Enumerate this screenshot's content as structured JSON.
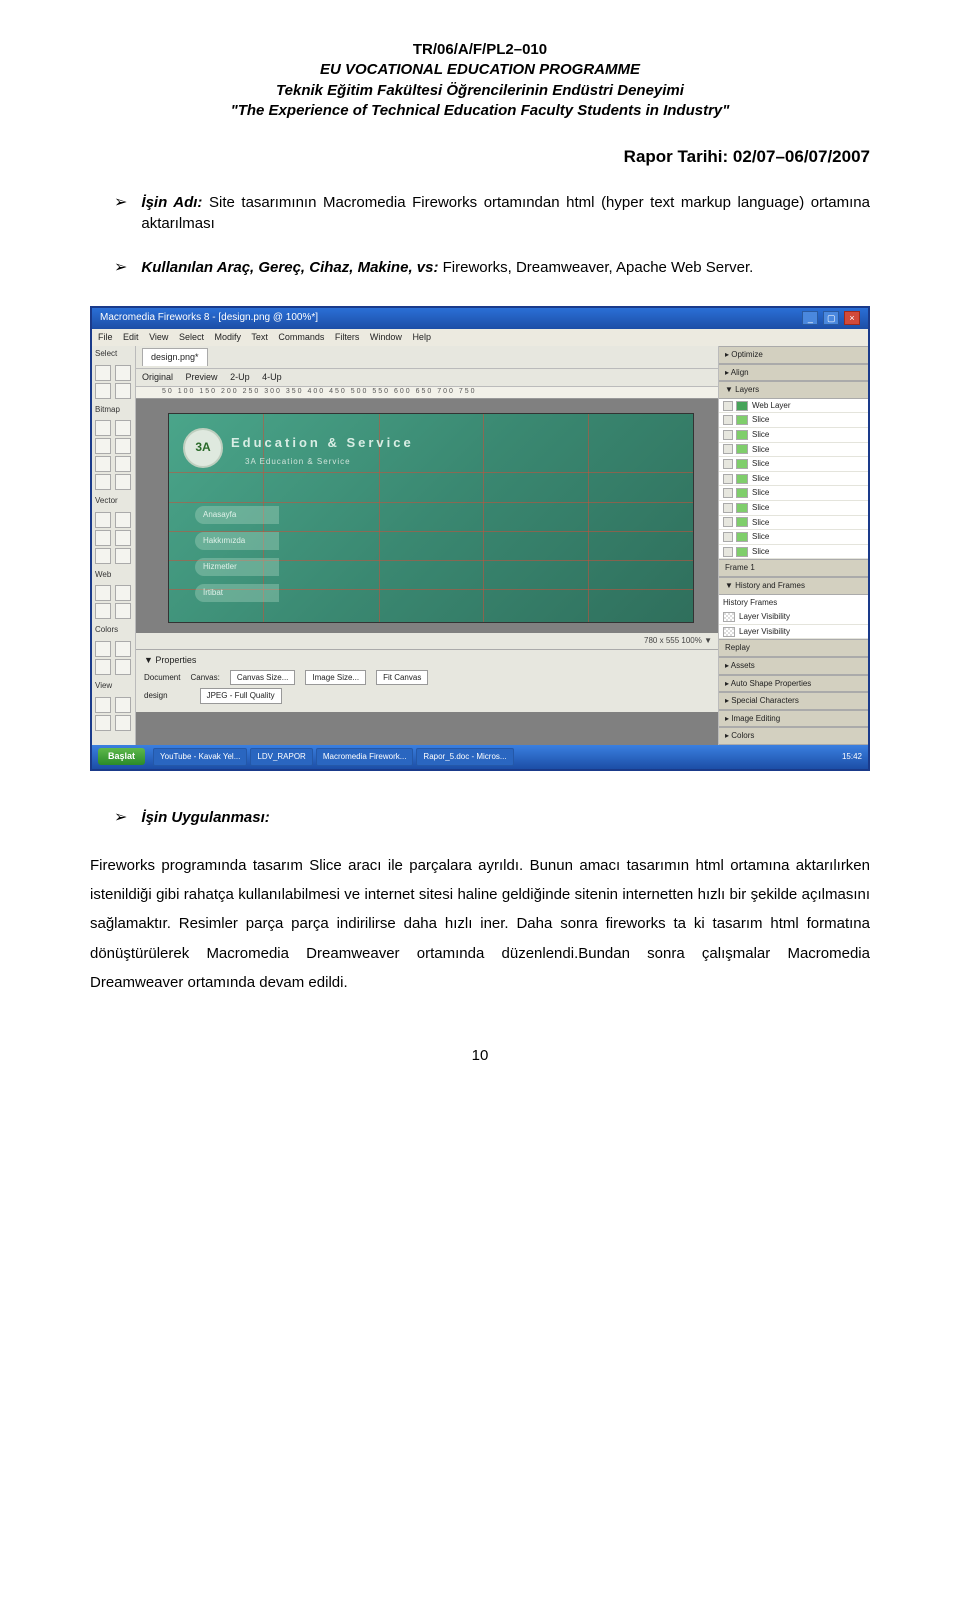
{
  "header": {
    "code": "TR/06/A/F/PL2–010",
    "line1": "EU VOCATIONAL EDUCATION PROGRAMME",
    "line2": "Teknik Eğitim Fakültesi Öğrencilerinin Endüstri Deneyimi",
    "line3": "\"The Experience of Technical Education Faculty Students in Industry\""
  },
  "report_date": "Rapor Tarihi: 02/07–06/07/2007",
  "bullets": {
    "job_name_label": "İşin Adı:",
    "job_name_text": " Site tasarımının Macromedia Fireworks ortamından html (hyper text markup language) ortamına aktarılması",
    "tools_label": "Kullanılan Araç, Gereç, Cihaz, Makine, vs:",
    "tools_text": "  Fireworks, Dreamweaver, Apache Web Server.",
    "apply_label": "İşin Uygulanması:"
  },
  "screenshot": {
    "titlebar": "Macromedia Fireworks 8 - [design.png @ 100%*]",
    "menubar": [
      "File",
      "Edit",
      "View",
      "Select",
      "Modify",
      "Text",
      "Commands",
      "Filters",
      "Window",
      "Help"
    ],
    "tool_sections": [
      "Select",
      "Bitmap",
      "Vector",
      "Web",
      "Colors",
      "View"
    ],
    "doc_tab": "design.png*",
    "view_modes": [
      "Original",
      "Preview",
      "2-Up",
      "4-Up"
    ],
    "ruler": "50   100   150   200   250   300   350   400   450   500   550   600   650   700   750",
    "canvas": {
      "logo": "3A",
      "heading": "Education & Service",
      "subheading": "3A Education & Service",
      "menu": [
        "Anasayfa",
        "Hakkımızda",
        "Hizmetler",
        "İrtibat"
      ]
    },
    "status": "780 x 555   100%  ▼",
    "properties": {
      "title": "▼ Properties",
      "doc_label": "Document",
      "doc_name": "design",
      "canvas_label": "Canvas:",
      "canvas_size": "Canvas Size...",
      "image_size": "Image Size...",
      "fit_canvas": "Fit Canvas",
      "gif": "JPEG - Full Quality"
    },
    "right_panels": {
      "optimize": "▸ Optimize",
      "align": "▸ Align",
      "layers": "▼ Layers",
      "layer_rows": [
        {
          "label": "Web Layer",
          "type": "web"
        },
        {
          "label": "Slice",
          "type": "slice"
        },
        {
          "label": "Slice",
          "type": "slice"
        },
        {
          "label": "Slice",
          "type": "slice"
        },
        {
          "label": "Slice",
          "type": "slice"
        },
        {
          "label": "Slice",
          "type": "slice"
        },
        {
          "label": "Slice",
          "type": "slice"
        },
        {
          "label": "Slice",
          "type": "slice"
        },
        {
          "label": "Slice",
          "type": "slice"
        },
        {
          "label": "Slice",
          "type": "slice"
        },
        {
          "label": "Slice",
          "type": "slice"
        }
      ],
      "frames": "Frame 1",
      "history": "▼ History and Frames",
      "history_tabs": "History   Frames",
      "history_rows": [
        "Layer Visibility",
        "Layer Visibility"
      ],
      "replay": "Replay",
      "assets": "▸ Assets",
      "autoshape": "▸ Auto Shape Properties",
      "special": "▸ Special Characters",
      "imgedit": "▸ Image Editing",
      "colors": "▸ Colors"
    },
    "taskbar": {
      "start": "Başlat",
      "tasks": [
        "YouTube - Kavak Yel...",
        "LDV_RAPOR",
        "Macromedia Firework...",
        "Rapor_5.doc - Micros..."
      ],
      "tray_time": "15:42"
    }
  },
  "body_text": "Fireworks programında tasarım Slice aracı ile parçalara ayrıldı. Bunun amacı tasarımın html ortamına aktarılırken istenildiği gibi rahatça kullanılabilmesi ve internet sitesi haline geldiğinde sitenin internetten hızlı bir şekilde açılmasını sağlamaktır. Resimler parça parça indirilirse daha hızlı iner. Daha sonra fireworks ta ki tasarım html formatına dönüştürülerek Macromedia Dreamweaver ortamında düzenlendi.Bundan sonra çalışmalar Macromedia Dreamweaver ortamında devam edildi.",
  "page_no": "10"
}
